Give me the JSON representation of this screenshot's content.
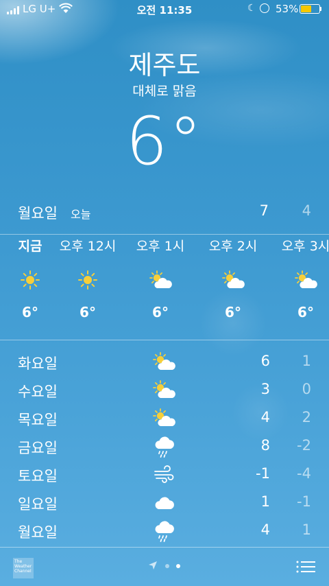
{
  "status_bar": {
    "carrier": "LG U+",
    "time": "오전 11:35",
    "battery_percent": "53%",
    "battery_level": 0.53,
    "battery_color": "#f7c800"
  },
  "header": {
    "city": "제주도",
    "condition": "대체로 맑음",
    "current_temp": "6°"
  },
  "today": {
    "day": "월요일",
    "tag": "오늘",
    "high": "7",
    "low": "4"
  },
  "hourly": [
    {
      "label": "지금",
      "icon": "sun-icon",
      "temp": "6°"
    },
    {
      "label": "오후 12시",
      "icon": "sun-icon",
      "temp": "6°"
    },
    {
      "label": "오후 1시",
      "icon": "partly-cloudy-icon",
      "temp": "6°"
    },
    {
      "label": "오후 2시",
      "icon": "partly-cloudy-icon",
      "temp": "6°"
    },
    {
      "label": "오후 3시",
      "icon": "partly-cloudy-icon",
      "temp": "6°"
    }
  ],
  "daily": [
    {
      "day": "화요일",
      "icon": "partly-cloudy-icon",
      "high": "6",
      "low": "1"
    },
    {
      "day": "수요일",
      "icon": "partly-cloudy-icon",
      "high": "3",
      "low": "0"
    },
    {
      "day": "목요일",
      "icon": "partly-cloudy-icon",
      "high": "4",
      "low": "2"
    },
    {
      "day": "금요일",
      "icon": "rain-icon",
      "high": "8",
      "low": "-2"
    },
    {
      "day": "토요일",
      "icon": "wind-icon",
      "high": "-1",
      "low": "-4"
    },
    {
      "day": "일요일",
      "icon": "cloud-icon",
      "high": "1",
      "low": "-1"
    },
    {
      "day": "월요일",
      "icon": "rain-icon",
      "high": "4",
      "low": "1"
    }
  ],
  "toolbar": {
    "weather_channel_logo": "The Weather Channel",
    "page_count": 3,
    "current_page": 3
  }
}
